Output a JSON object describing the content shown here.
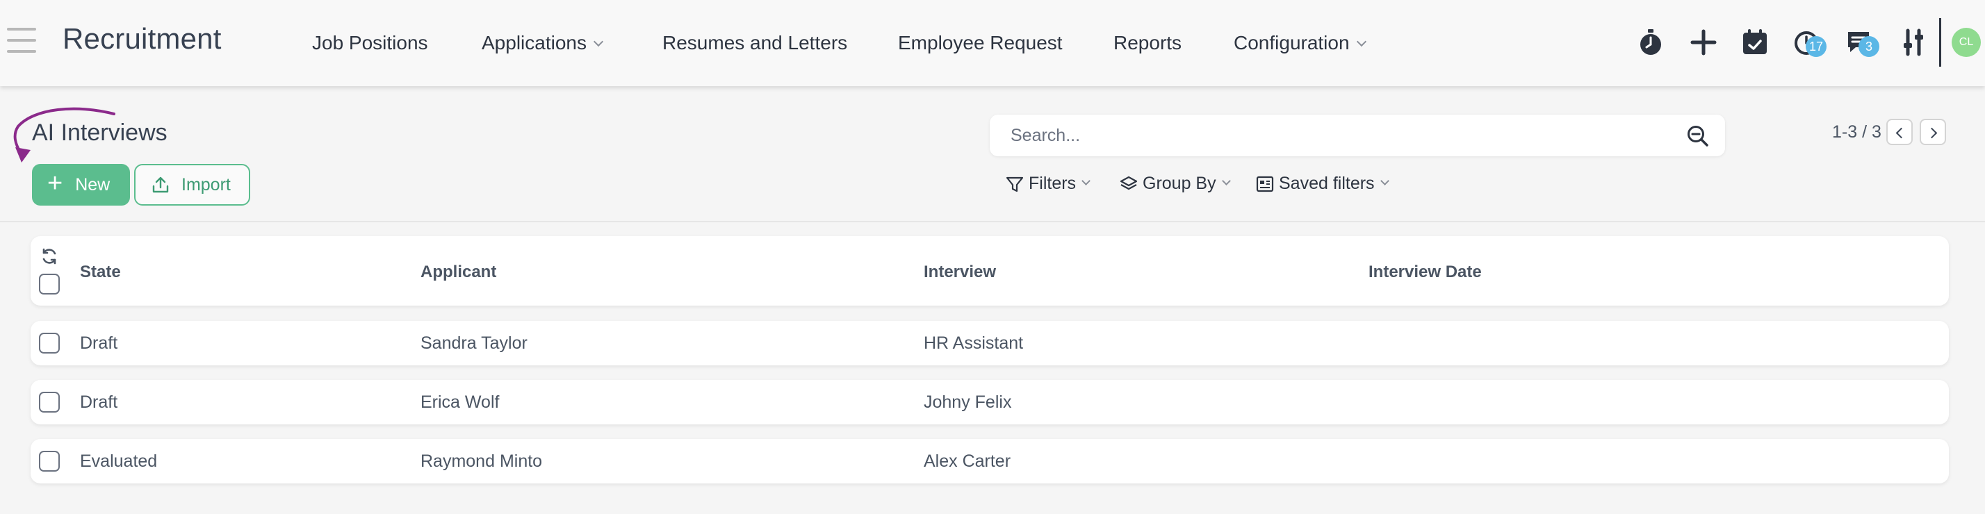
{
  "app": {
    "title": "Recruitment"
  },
  "nav": {
    "items": [
      {
        "label": "Job Positions"
      },
      {
        "label": "Applications"
      },
      {
        "label": "Resumes and Letters"
      },
      {
        "label": "Employee Request"
      },
      {
        "label": "Reports"
      },
      {
        "label": "Configuration"
      }
    ]
  },
  "systray": {
    "activity_badge": "17",
    "messages_badge": "3",
    "avatar_initials": "CL"
  },
  "page": {
    "title": "AI Interviews",
    "new_label": "New",
    "import_label": "Import"
  },
  "search": {
    "placeholder": "Search..."
  },
  "filters": {
    "filters_label": "Filters",
    "group_by_label": "Group By",
    "saved_filters_label": "Saved filters"
  },
  "pager": {
    "text": "1-3 / 3"
  },
  "table": {
    "columns": [
      "State",
      "Applicant",
      "Interview",
      "Interview Date"
    ],
    "rows": [
      {
        "state": "Draft",
        "applicant": "Sandra Taylor",
        "interview": "HR Assistant",
        "date": ""
      },
      {
        "state": "Draft",
        "applicant": "Erica Wolf",
        "interview": "Johny Felix",
        "date": ""
      },
      {
        "state": "Evaluated",
        "applicant": "Raymond Minto",
        "interview": "Alex Carter",
        "date": ""
      }
    ]
  },
  "colors": {
    "primary": "#5bbd8e",
    "badge": "#5bb7e6",
    "avatar": "#8fdb8f",
    "annotation_arrow": "#8b2a8b"
  }
}
